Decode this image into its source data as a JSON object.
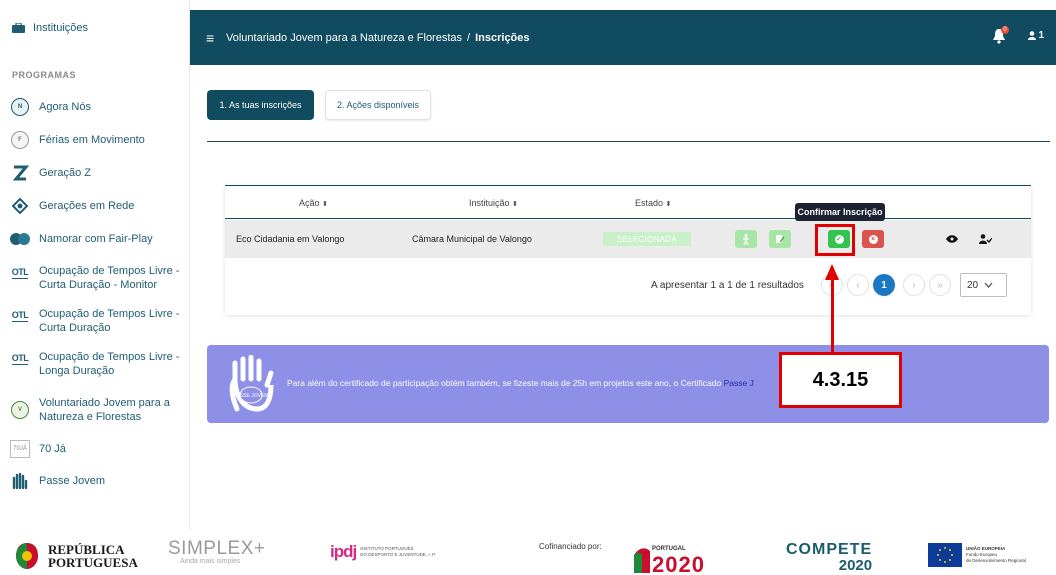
{
  "sidebar": {
    "institutions_label": "Instituições",
    "section_title": "PROGRAMAS",
    "items": [
      {
        "label": "Agora Nós",
        "icon": "agora-nos-logo"
      },
      {
        "label": "Férias em Movimento",
        "icon": "ferias-logo"
      },
      {
        "label": "Geração Z",
        "icon": "geracao-z-logo"
      },
      {
        "label": "Gerações em Rede",
        "icon": "geracoes-rede-logo"
      },
      {
        "label": "Namorar com Fair-Play",
        "icon": "fair-play-logo"
      },
      {
        "label": "Ocupação de Tempos Livre - Curta Duração - Monitor",
        "icon": "otl-logo"
      },
      {
        "label": "Ocupação de Tempos Livre - Curta Duração",
        "icon": "otl-logo"
      },
      {
        "label": "Ocupação de Tempos Livre - Longa Duração",
        "icon": "otl-logo"
      },
      {
        "label": "Voluntariado Jovem para a Natureza e Florestas",
        "icon": "voluntariado-logo"
      },
      {
        "label": "70 Já",
        "icon": "70ja-logo"
      },
      {
        "label": "Passe Jovem",
        "icon": "passe-jovem-logo"
      }
    ],
    "otl_text": "OTL",
    "otl_small": "OTL"
  },
  "topbar": {
    "breadcrumb_parent": "Voluntariado Jovem para a Natureza e Florestas",
    "breadcrumb_sep": "/",
    "breadcrumb_current": "Inscrições",
    "notification_count": "0",
    "user_count": "1",
    "bg_color": "#104b5f"
  },
  "tabs": [
    {
      "label": "1. As tuas inscrições"
    },
    {
      "label": "2. Ações disponíveis"
    }
  ],
  "table": {
    "headers": [
      "Ação",
      "Instituição",
      "Estado"
    ],
    "row": {
      "acao": "Eco Cidadania em Valongo",
      "instituicao": "Câmara Municipal de Valongo",
      "estado": "SELECIONADA"
    },
    "tooltip": "Confirmar Inscrição"
  },
  "pagination": {
    "summary": "A apresentar 1 a 1 de 1 resultados",
    "first": "«",
    "prev": "‹",
    "current": "1",
    "next": "›",
    "last": "»",
    "page_size": "20"
  },
  "annotation": {
    "label": "4.3.15"
  },
  "banner": {
    "text": "Para além do certificado de participação obtém também, se fizeste mais de 25h em projetos este ano, o Certificado",
    "link": "Passe J",
    "logo_text": "PASSE JOVEM"
  },
  "footer": {
    "republica_line1": "REPÚBLICA",
    "republica_line2": "PORTUGUESA",
    "simplex": "SIMPLEX+",
    "simplex_sub": "Ainda mais simples",
    "ipdj": "ipdj",
    "ipdj_line1": "INSTITUTO PORTUGUÊS",
    "ipdj_line2": "DO DESPORTO E JUVENTUDE, I. P.",
    "cofinanciado": "Cofinanciado por:",
    "portugal_label": "PORTUGAL",
    "portugal2020": "2020",
    "compete": "COMPETE",
    "compete2020": "2020",
    "ue_line1": "UNIÃO EUROPEIA",
    "ue_line2": "Fundo Europeu",
    "ue_line3": "de Desenvolvimento Regional"
  }
}
